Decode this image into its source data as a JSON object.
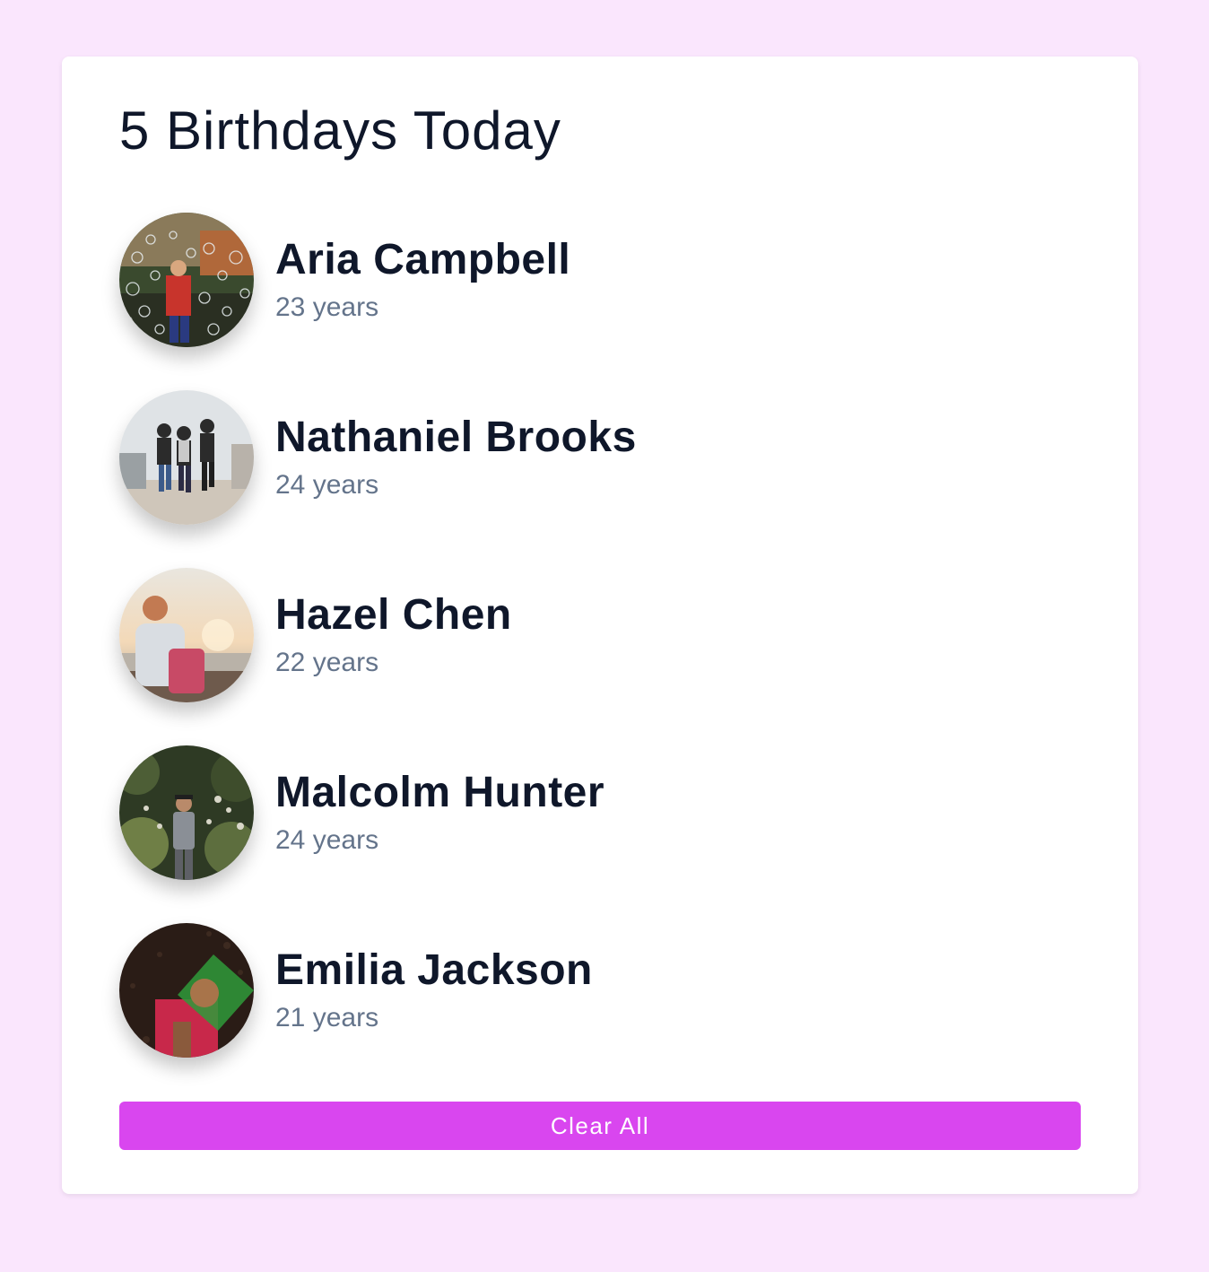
{
  "header": {
    "title": "5 Birthdays Today"
  },
  "people": [
    {
      "name": "Aria Campbell",
      "age": "23 years",
      "avatar": "photo-bubbles"
    },
    {
      "name": "Nathaniel Brooks",
      "age": "24 years",
      "avatar": "photo-group-jumping"
    },
    {
      "name": "Hazel Chen",
      "age": "22 years",
      "avatar": "photo-seaside"
    },
    {
      "name": "Malcolm Hunter",
      "age": "24 years",
      "avatar": "photo-garden"
    },
    {
      "name": "Emilia Jackson",
      "age": "21 years",
      "avatar": "photo-dark-portrait"
    }
  ],
  "actions": {
    "clear_label": "Clear All"
  },
  "colors": {
    "page_background": "#fae6fd",
    "card_background": "#ffffff",
    "accent": "#d946ef",
    "name_text": "#0f172a",
    "age_text": "#64748b"
  }
}
